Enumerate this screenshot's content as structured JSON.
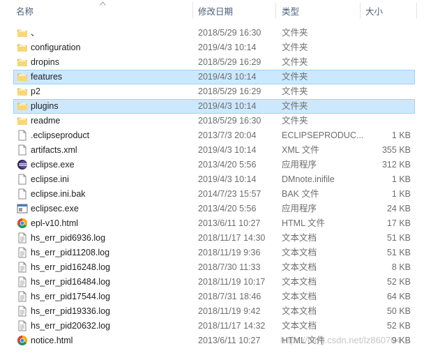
{
  "header": {
    "name": "名称",
    "date": "修改日期",
    "type": "类型",
    "size": "大小"
  },
  "rows": [
    {
      "name": "、",
      "date": "2018/5/29 16:30",
      "type": "文件夹",
      "size": "",
      "icon": "folder-icon",
      "selected": false
    },
    {
      "name": "configuration",
      "date": "2019/4/3 10:14",
      "type": "文件夹",
      "size": "",
      "icon": "folder-icon",
      "selected": false
    },
    {
      "name": "dropins",
      "date": "2018/5/29 16:29",
      "type": "文件夹",
      "size": "",
      "icon": "folder-icon",
      "selected": false
    },
    {
      "name": "features",
      "date": "2019/4/3 10:14",
      "type": "文件夹",
      "size": "",
      "icon": "folder-icon",
      "selected": true
    },
    {
      "name": "p2",
      "date": "2018/5/29 16:29",
      "type": "文件夹",
      "size": "",
      "icon": "folder-icon",
      "selected": false
    },
    {
      "name": "plugins",
      "date": "2019/4/3 10:14",
      "type": "文件夹",
      "size": "",
      "icon": "folder-icon",
      "selected": true
    },
    {
      "name": "readme",
      "date": "2018/5/29 16:30",
      "type": "文件夹",
      "size": "",
      "icon": "folder-icon",
      "selected": false
    },
    {
      "name": ".eclipseproduct",
      "date": "2013/7/3 20:04",
      "type": "ECLIPSEPRODUC...",
      "size": "1 KB",
      "icon": "file-icon",
      "selected": false
    },
    {
      "name": "artifacts.xml",
      "date": "2019/4/3 10:14",
      "type": "XML 文件",
      "size": "355 KB",
      "icon": "file-icon",
      "selected": false
    },
    {
      "name": "eclipse.exe",
      "date": "2013/4/20 5:56",
      "type": "应用程序",
      "size": "312 KB",
      "icon": "eclipse-icon",
      "selected": false
    },
    {
      "name": "eclipse.ini",
      "date": "2019/4/3 10:14",
      "type": "DMnote.inifile",
      "size": "1 KB",
      "icon": "file-icon",
      "selected": false
    },
    {
      "name": "eclipse.ini.bak",
      "date": "2014/7/23 15:57",
      "type": "BAK 文件",
      "size": "1 KB",
      "icon": "file-icon",
      "selected": false
    },
    {
      "name": "eclipsec.exe",
      "date": "2013/4/20 5:56",
      "type": "应用程序",
      "size": "24 KB",
      "icon": "exe-icon",
      "selected": false
    },
    {
      "name": "epl-v10.html",
      "date": "2013/6/11 10:27",
      "type": "HTML 文件",
      "size": "17 KB",
      "icon": "chrome-icon",
      "selected": false
    },
    {
      "name": "hs_err_pid6936.log",
      "date": "2018/11/17 14:30",
      "type": "文本文档",
      "size": "51 KB",
      "icon": "text-file-icon",
      "selected": false
    },
    {
      "name": "hs_err_pid11208.log",
      "date": "2018/11/19 9:36",
      "type": "文本文档",
      "size": "51 KB",
      "icon": "text-file-icon",
      "selected": false
    },
    {
      "name": "hs_err_pid16248.log",
      "date": "2018/7/30 11:33",
      "type": "文本文档",
      "size": "8 KB",
      "icon": "text-file-icon",
      "selected": false
    },
    {
      "name": "hs_err_pid16484.log",
      "date": "2018/11/19 10:17",
      "type": "文本文档",
      "size": "52 KB",
      "icon": "text-file-icon",
      "selected": false
    },
    {
      "name": "hs_err_pid17544.log",
      "date": "2018/7/31 18:46",
      "type": "文本文档",
      "size": "64 KB",
      "icon": "text-file-icon",
      "selected": false
    },
    {
      "name": "hs_err_pid19336.log",
      "date": "2018/11/19 9:42",
      "type": "文本文档",
      "size": "50 KB",
      "icon": "text-file-icon",
      "selected": false
    },
    {
      "name": "hs_err_pid20632.log",
      "date": "2018/11/17 14:32",
      "type": "文本文档",
      "size": "52 KB",
      "icon": "text-file-icon",
      "selected": false
    },
    {
      "name": "notice.html",
      "date": "2013/6/11 10:27",
      "type": "HTML 文件",
      "size": "9 KB",
      "icon": "chrome-icon",
      "selected": false
    }
  ],
  "watermark": "https://blog.csdn.net/lz860704",
  "colors": {
    "selection": "#cce8ff",
    "selection_border": "#99d1ff",
    "folder": "#f8d775",
    "header_text": "#4c607a"
  }
}
